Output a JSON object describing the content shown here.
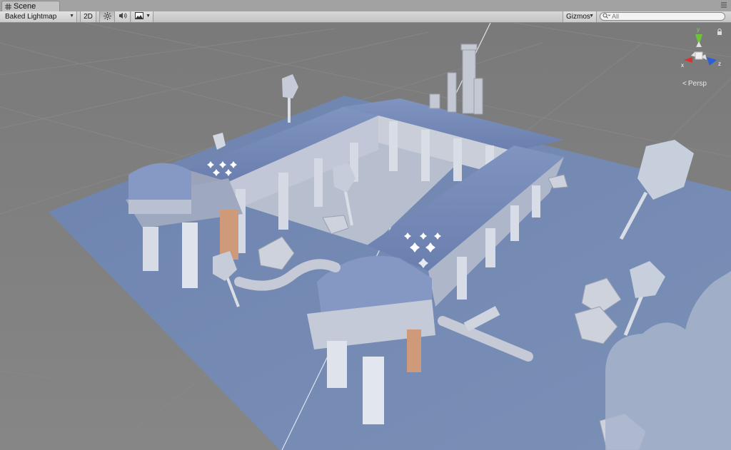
{
  "tab": {
    "title": "Scene",
    "icon": "grid-icon",
    "menu_icon": "menu-icon"
  },
  "toolbar": {
    "render_mode": "Baked Lightmap",
    "mode_2d": "2D",
    "lighting_icon": "sun-icon",
    "audio_icon": "speaker-icon",
    "effects_icon": "image-icon",
    "gizmos": "Gizmos",
    "search_value": "All",
    "search_icon": "search-icon"
  },
  "view": {
    "projection_label": "Persp",
    "gizmo_axes": {
      "x": "x",
      "y": "y",
      "z": "z"
    },
    "axis_colors": {
      "x": "#d9342b",
      "y": "#6fc23a",
      "z": "#2c5fd6"
    }
  },
  "colors": {
    "background": "#7f7f7f",
    "ground": "#6f86b0",
    "building": "#b9c3d6"
  }
}
